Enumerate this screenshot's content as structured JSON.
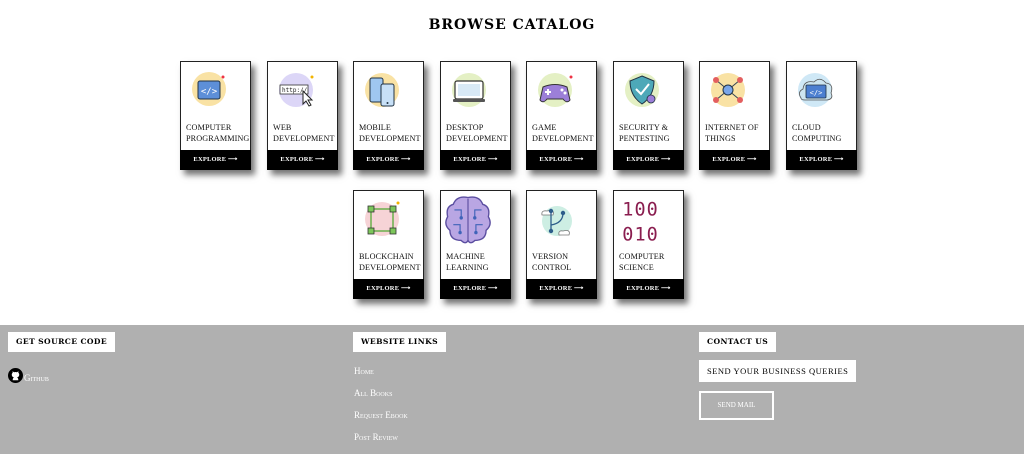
{
  "catalog": {
    "title": "BROWSE CATALOG",
    "cards": [
      {
        "label": "COMPUTER PROGRAMMING",
        "button": "EXPLORE ⟶",
        "icon": "code-icon"
      },
      {
        "label": "WEB DEVELOPMENT",
        "button": "EXPLORE ⟶",
        "icon": "web-cursor-icon"
      },
      {
        "label": "MOBILE DEVELOPMENT",
        "button": "EXPLORE ⟶",
        "icon": "mobile-icon"
      },
      {
        "label": "DESKTOP DEVELOPMENT",
        "button": "EXPLORE ⟶",
        "icon": "desktop-icon"
      },
      {
        "label": "GAME DEVELOPMENT",
        "button": "EXPLORE ⟶",
        "icon": "gamepad-icon"
      },
      {
        "label": "SECURITY & PENTESTING",
        "button": "EXPLORE ⟶",
        "icon": "shield-icon"
      },
      {
        "label": "INTERNET OF THINGS",
        "button": "EXPLORE ⟶",
        "icon": "network-icon"
      },
      {
        "label": "CLOUD COMPUTING",
        "button": "EXPLORE ⟶",
        "icon": "cloud-code-icon"
      },
      {
        "label": "BLOCKCHAIN DEVELOPMENT",
        "button": "EXPLORE ⟶",
        "icon": "blockchain-icon"
      },
      {
        "label": "MACHINE LEARNING",
        "button": "EXPLORE ⟶",
        "icon": "brain-icon"
      },
      {
        "label": "VERSION CONTROL",
        "button": "EXPLORE ⟶",
        "icon": "branch-icon"
      },
      {
        "label": "COMPUTER SCIENCE",
        "button": "EXPLORE ⟶",
        "icon": "binary-icon",
        "binary_lines": [
          "100",
          "010"
        ]
      }
    ]
  },
  "footer": {
    "source": {
      "heading": "GET SOURCE CODE",
      "github_label": "Github"
    },
    "links": {
      "heading": "WEBSITE LINKS",
      "items": [
        "Home",
        "All Books",
        "Request Ebook",
        "Post Review"
      ]
    },
    "contact": {
      "heading": "CONTACT US",
      "queries": "SEND YOUR BUSINESS QUERIES",
      "send_mail": "SEND MAIL"
    }
  }
}
